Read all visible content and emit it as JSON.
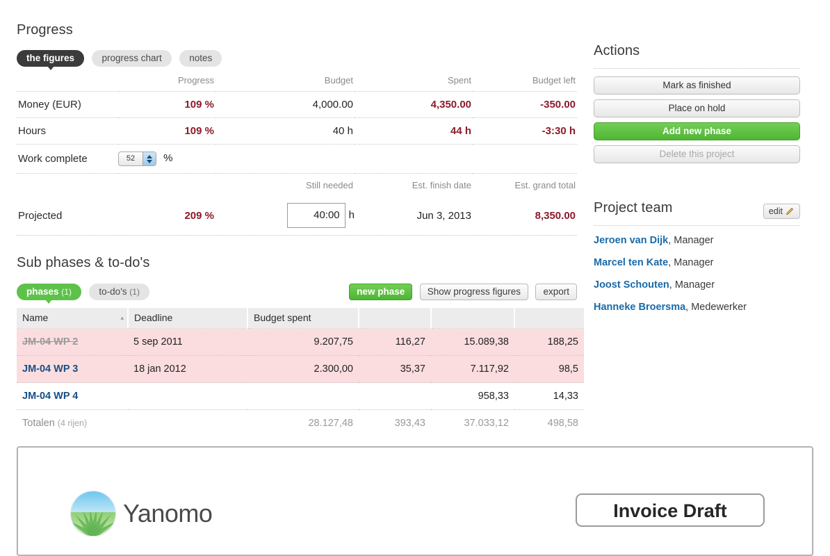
{
  "progress": {
    "title": "Progress",
    "tabs": [
      {
        "label": "the figures",
        "active": true
      },
      {
        "label": "progress chart",
        "active": false
      },
      {
        "label": "notes",
        "active": false
      }
    ],
    "columns": [
      "Progress",
      "Budget",
      "Spent",
      "Budget left"
    ],
    "rows": [
      {
        "label": "Money (EUR)",
        "progress": "109 %",
        "budget": "4,000.00",
        "spent": "4,350.00",
        "budget_left": "-350.00"
      },
      {
        "label": "Hours",
        "progress": "109 %",
        "budget": "40 h",
        "spent": "44 h",
        "budget_left": "-3:30 h"
      }
    ],
    "work_complete": {
      "label": "Work complete",
      "value": "52",
      "unit": "%"
    },
    "projected": {
      "label": "Projected",
      "percent": "209 %",
      "still_needed_header": "Still needed",
      "still_needed_value": "40:00",
      "still_needed_unit": "h",
      "finish_date_header": "Est. finish date",
      "finish_date": "Jun 3, 2013",
      "grand_total_header": "Est. grand total",
      "grand_total": "8,350.00"
    }
  },
  "subphases": {
    "title": "Sub phases & to-do's",
    "tabs": [
      {
        "label": "phases",
        "count": "(1)",
        "active": true
      },
      {
        "label": "to-do's",
        "count": "(1)",
        "active": false
      }
    ],
    "buttons": [
      {
        "label": "new phase",
        "style": "green"
      },
      {
        "label": "Show progress figures",
        "style": "default"
      },
      {
        "label": "export",
        "style": "default"
      }
    ],
    "columns": [
      "Name",
      "Deadline",
      "Budget spent",
      "",
      "",
      ""
    ],
    "sort_indicator": "▴",
    "rows": [
      {
        "name": "JM-04 WP 2",
        "deadline": "5 sep 2011",
        "budget_spent": "9.207,75",
        "col4": "116,27",
        "col5": "15.089,38",
        "col6": "188,25",
        "highlight": true,
        "completed": true
      },
      {
        "name": "JM-04 WP 3",
        "deadline": "18 jan 2012",
        "budget_spent": "2.300,00",
        "col4": "35,37",
        "col5": "7.117,92",
        "col6": "98,5",
        "highlight": true,
        "completed": false
      },
      {
        "name": "JM-04 WP 4",
        "deadline": "",
        "budget_spent": "",
        "col4": "",
        "col5": "958,33",
        "col6": "14,33",
        "highlight": false,
        "completed": false
      }
    ],
    "totals": {
      "label": "Totalen",
      "rowcount": "(4 rijen)",
      "deadline": "",
      "budget_spent": "28.127,48",
      "col4": "393,43",
      "col5": "37.033,12",
      "col6": "498,58"
    }
  },
  "actions": {
    "title": "Actions",
    "buttons": [
      {
        "label": "Mark as finished",
        "style": "default"
      },
      {
        "label": "Place on hold",
        "style": "default"
      },
      {
        "label": "Add new phase",
        "style": "green"
      },
      {
        "label": "Delete this project",
        "style": "disabled"
      }
    ]
  },
  "team": {
    "title": "Project team",
    "edit_label": "edit",
    "members": [
      {
        "name": "Jeroen van Dijk",
        "role": ", Manager"
      },
      {
        "name": "Marcel ten Kate",
        "role": ", Manager"
      },
      {
        "name": "Joost Schouten",
        "role": ", Manager"
      },
      {
        "name": "Hanneke Broersma",
        "role": ", Medewerker"
      }
    ]
  },
  "invoice": {
    "brand": "Yanomo",
    "badge": "Invoice Draft"
  },
  "colors": {
    "accent_red": "#8c1a2c",
    "green": "#5ec24a",
    "link_blue": "#1a6aa8",
    "row_highlight": "#fbdde0"
  }
}
